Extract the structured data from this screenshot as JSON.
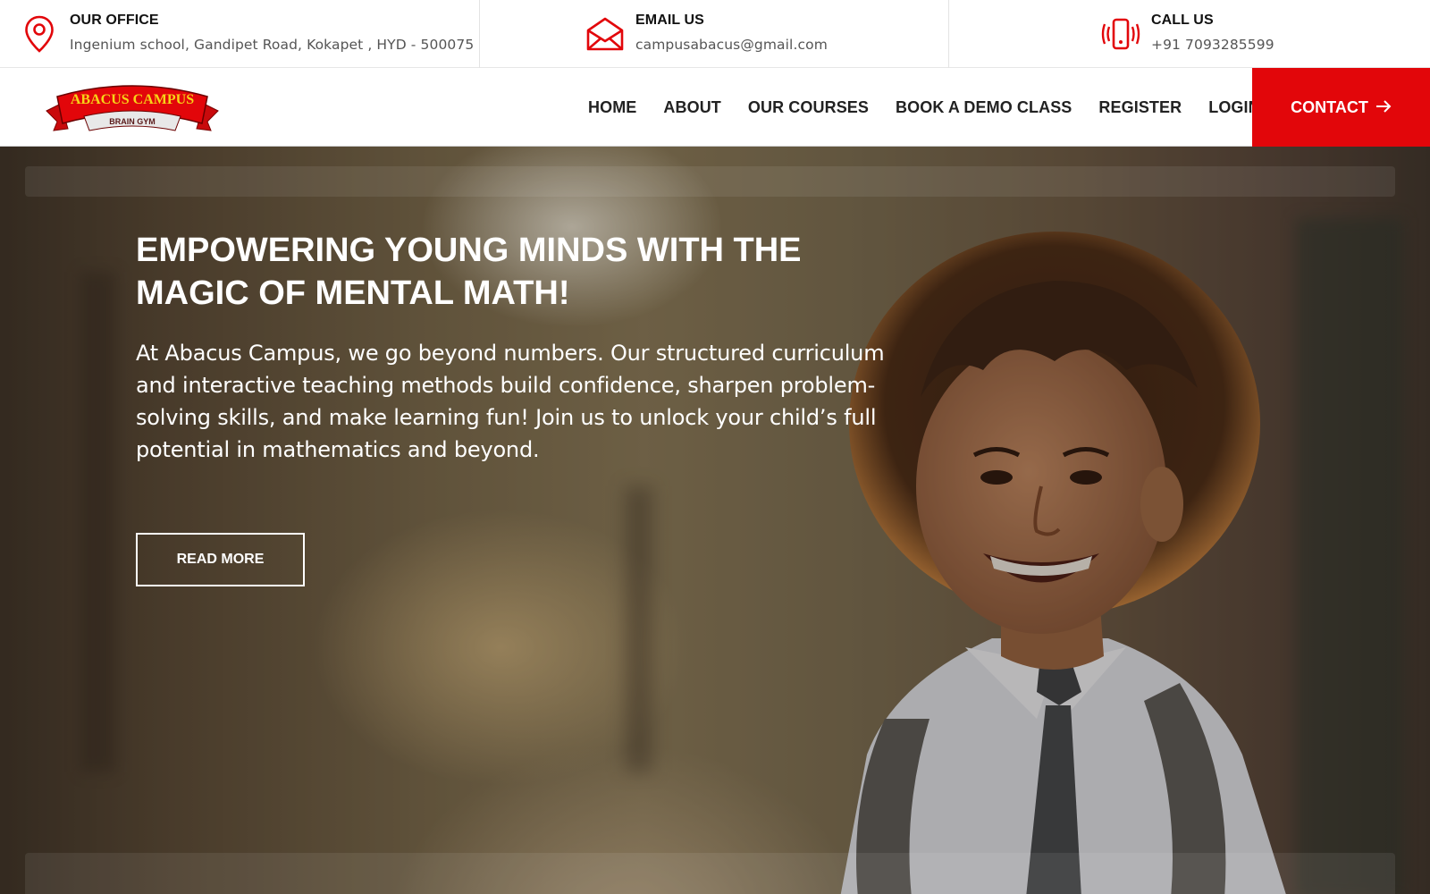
{
  "topbar": {
    "office": {
      "title": "OUR OFFICE",
      "value": "Ingenium school, Gandipet Road, Kokapet , HYD - 500075",
      "icon": "map-pin-icon"
    },
    "email": {
      "title": "EMAIL US",
      "value": "campusabacus@gmail.com",
      "icon": "envelope-icon"
    },
    "call": {
      "title": "CALL US",
      "value": "+91 7093285599",
      "icon": "phone-ringing-icon"
    }
  },
  "logo": {
    "line1": "ABACUS CAMPUS",
    "line2": "BRAIN GYM"
  },
  "nav": {
    "items": [
      "HOME",
      "ABOUT",
      "OUR COURSES",
      "BOOK A DEMO CLASS",
      "REGISTER",
      "LOGIN"
    ],
    "contact_label": "CONTACT",
    "contact_icon": "arrow-right-icon"
  },
  "hero": {
    "heading": "EMPOWERING YOUNG MINDS WITH THE MAGIC OF MENTAL MATH!",
    "body": "At Abacus Campus, we go beyond numbers. Our structured curriculum and interactive teaching methods build confidence, sharpen problem-solving skills, and make learning fun! Join us to unlock your child’s full potential in mathematics and beyond.",
    "button_label": "READ MORE"
  },
  "colors": {
    "accent": "#e2060a",
    "logo_yellow": "#f7d417",
    "text_dark": "#222222",
    "text_muted": "#555555"
  }
}
